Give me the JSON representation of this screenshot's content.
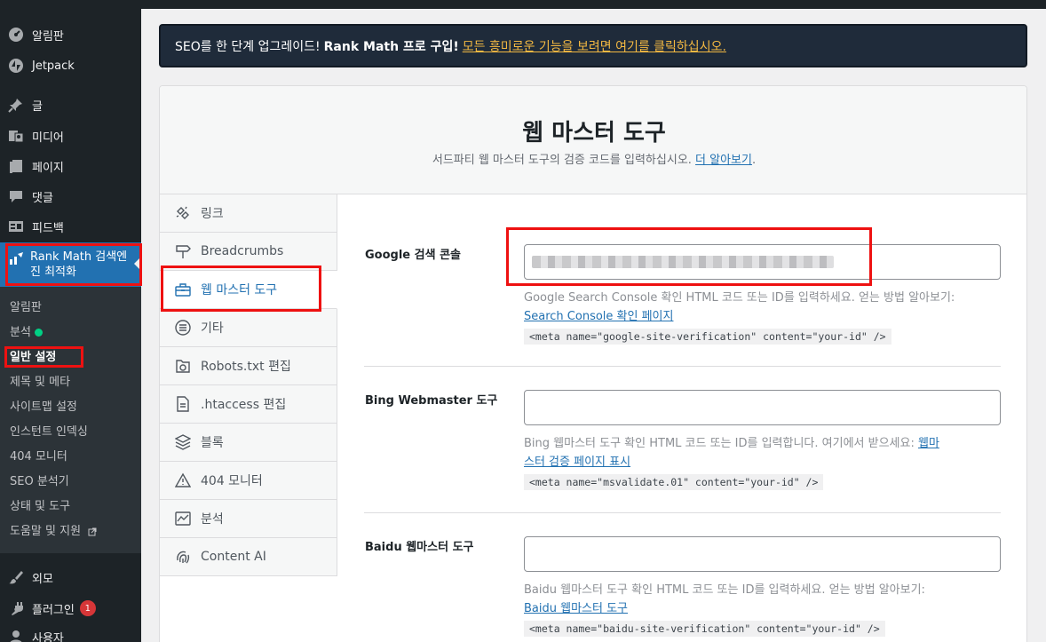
{
  "sidebar": {
    "top_items": [
      {
        "label": "알림판",
        "icon": "dashboard-icon"
      },
      {
        "label": "Jetpack",
        "icon": "jetpack-icon"
      },
      {
        "label": "글",
        "icon": "pin-icon"
      },
      {
        "label": "미디어",
        "icon": "media-icon"
      },
      {
        "label": "페이지",
        "icon": "page-icon"
      },
      {
        "label": "댓글",
        "icon": "comment-icon"
      },
      {
        "label": "피드백",
        "icon": "feedback-icon"
      }
    ],
    "rank_math": {
      "label": "Rank Math 검색엔진 최적화",
      "icon": "rank-math-icon"
    },
    "submenu": [
      {
        "label": "알림판"
      },
      {
        "label": "분석"
      },
      {
        "label": "일반 설정"
      },
      {
        "label": "제목 및 메타"
      },
      {
        "label": "사이트맵 설정"
      },
      {
        "label": "인스턴트 인덱싱"
      },
      {
        "label": "404 모니터"
      },
      {
        "label": "SEO 분석기"
      },
      {
        "label": "상태 및 도구"
      },
      {
        "label": "도움말 및 지원"
      }
    ],
    "bottom_items": [
      {
        "label": "외모",
        "icon": "brush-icon"
      },
      {
        "label": "플러그인",
        "icon": "plugin-icon",
        "badge": "1"
      },
      {
        "label": "사용자",
        "icon": "user-icon"
      }
    ]
  },
  "banner": {
    "text": "SEO를 한 단계 업그레이드!",
    "strong": "Rank Math 프로 구입!",
    "link": "모든 흥미로운 기능을 보려면 여기를 클릭하십시오."
  },
  "panel": {
    "title": "웹 마스터 도구",
    "desc": "서드파티 웹 마스터 도구의 검증 코드를 입력하십시오.",
    "desc_link": "더 알아보기",
    "desc_end": "."
  },
  "tabs": [
    {
      "label": "링크",
      "icon": "link-icon"
    },
    {
      "label": "Breadcrumbs",
      "icon": "signpost-icon"
    },
    {
      "label": "웹 마스터 도구",
      "icon": "toolbox-icon"
    },
    {
      "label": "기타",
      "icon": "list-icon"
    },
    {
      "label": "Robots.txt 편집",
      "icon": "folder-icon"
    },
    {
      "label": ".htaccess 편집",
      "icon": "file-icon"
    },
    {
      "label": "블록",
      "icon": "blocks-icon"
    },
    {
      "label": "404 모니터",
      "icon": "warning-icon"
    },
    {
      "label": "분석",
      "icon": "analytics-icon"
    },
    {
      "label": "Content AI",
      "icon": "fingerprint-icon"
    }
  ],
  "fields": {
    "google": {
      "label": "Google 검색 콘솔",
      "desc": "Google Search Console 확인 HTML 코드 또는 ID를 입력하세요. 얻는 방법 알아보기:",
      "link": "Search Console 확인 페이지",
      "code": "<meta name=\"google-site-verification\" content=\"your-id\" />"
    },
    "bing": {
      "label": "Bing Webmaster 도구",
      "desc": "Bing 웹마스터 도구 확인 HTML 코드 또는 ID를 입력합니다. 여기에서 받으세요:",
      "link_a": "웹마",
      "link_b": "스터 검증 페이지 표시",
      "code": "<meta name=\"msvalidate.01\" content=\"your-id\" />"
    },
    "baidu": {
      "label": "Baidu 웹마스터 도구",
      "desc": "Baidu 웹마스터 도구 확인 HTML 코드 또는 ID를 입력하세요. 얻는 방법 알아보기:",
      "link": "Baidu 웹마스터 도구",
      "code": "<meta name=\"baidu-site-verification\" content=\"your-id\" />"
    }
  },
  "colors": {
    "accent": "#2271b1",
    "highlight": "#e11111",
    "banner_link": "#f4b942"
  }
}
